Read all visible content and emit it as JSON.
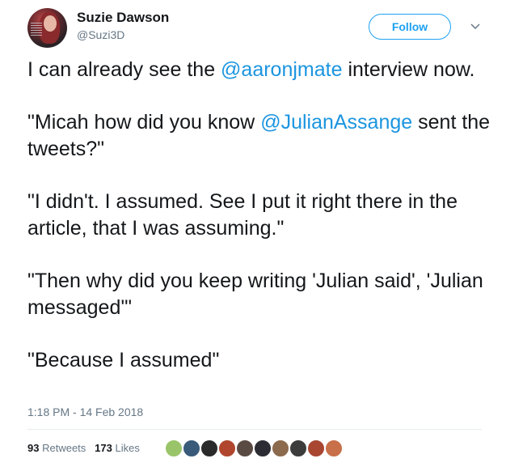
{
  "user": {
    "name": "Suzie Dawson",
    "handle": "@Suzi3D"
  },
  "follow_label": "Follow",
  "tweet": {
    "p1_pre": "I can already see the ",
    "p1_mention": "@aaronjmate",
    "p1_post": " interview now.",
    "p2_pre": "\"Micah how did you know ",
    "p2_mention": "@JulianAssange",
    "p2_post": " sent the tweets?\"",
    "p3": "\"I didn't. I assumed. See I put it right there in the article, that I was assuming.\"",
    "p4": "\"Then why did you keep writing 'Julian said', 'Julian messaged'\"",
    "p5": "\"Because I assumed\""
  },
  "timestamp": "1:18 PM - 14 Feb 2018",
  "stats": {
    "retweets_count": "93",
    "retweets_label": "Retweets",
    "likes_count": "173",
    "likes_label": "Likes"
  },
  "colors": {
    "accent": "#1da1f2",
    "mention": "#1b95e0",
    "secondary_text": "#657786"
  }
}
